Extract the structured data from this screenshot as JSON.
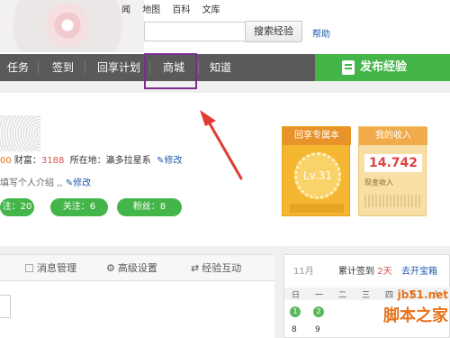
{
  "top": {
    "links": [
      "闻",
      "地图",
      "百科",
      "文库"
    ],
    "search_placeholder": "",
    "search_button": "搜索经验",
    "help": "帮助"
  },
  "nav": {
    "items": [
      "任务",
      "签到",
      "回享计划",
      "商城",
      "知道"
    ],
    "publish": "发布经验",
    "accent": "#44b549",
    "highlight_color": "#7a2d8f"
  },
  "profile": {
    "stats": {
      "value_tail": "00",
      "wealth_label": "财富：",
      "wealth": "3188",
      "location_label": "所在地：",
      "location": "瀛多拉星系",
      "edit": "修改"
    },
    "intro": "填写个人介绍",
    "intro_edit": "修改",
    "pills": [
      "注：20",
      "关注：6",
      "粉丝：8"
    ]
  },
  "badge": {
    "title": "回享专属本",
    "level": "Lv.31"
  },
  "income": {
    "title": "我的收入",
    "value": "14.742",
    "label": "现金收入"
  },
  "tabs": [
    "消息管理",
    "高级设置",
    "经验互动"
  ],
  "calendar": {
    "month": "11月",
    "sign_prefix": "累计签到",
    "sign_days": "2天",
    "link": "去开宝箱",
    "weekdays": [
      "日",
      "一",
      "二",
      "三",
      "四",
      "五",
      "六"
    ],
    "signed_days": [
      "1",
      "2"
    ],
    "days": [
      "8",
      "9"
    ]
  },
  "watermark": {
    "url": "jb51.net",
    "name": "脚本之家"
  }
}
